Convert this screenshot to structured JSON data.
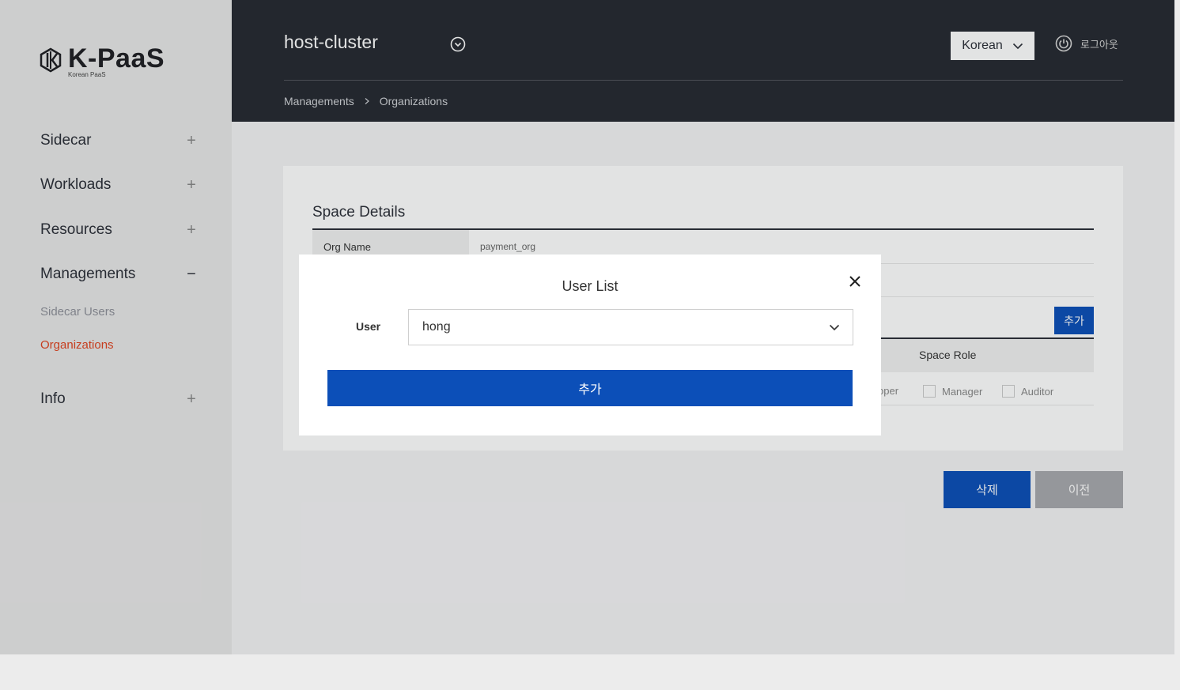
{
  "brand": {
    "logo_text": "K-PaaS",
    "logo_sub": "Korean PaaS",
    "logo_icon": "k-paas-logo-icon"
  },
  "sidebar": {
    "items": [
      {
        "label": "Sidecar",
        "toggle": "+"
      },
      {
        "label": "Workloads",
        "toggle": "+"
      },
      {
        "label": "Resources",
        "toggle": "+"
      },
      {
        "label": "Managements",
        "toggle": "−"
      },
      {
        "label": "Info",
        "toggle": "+"
      }
    ],
    "sub_items": [
      {
        "label": "Sidecar Users",
        "active": false
      },
      {
        "label": "Organizations",
        "active": true
      }
    ],
    "active_color": "#e0431f"
  },
  "header": {
    "cluster": "host-cluster",
    "language": "Korean",
    "logout_label": "로그아웃",
    "breadcrumb": [
      "Managements",
      "Organizations"
    ],
    "background": "#262931"
  },
  "main": {
    "section_title": "Space Details",
    "org_name_label": "Org Name",
    "org_name_value": "payment_org",
    "add_label": "추가",
    "table_header_space_role": "Space Role",
    "permissions": [
      "oper",
      "Manager",
      "Auditor"
    ],
    "delete_label": "삭제",
    "prev_label": "이전",
    "accent": "#0c4fb8"
  },
  "modal": {
    "title": "User List",
    "user_label": "User",
    "user_value": "hong",
    "add_label": "추가"
  }
}
